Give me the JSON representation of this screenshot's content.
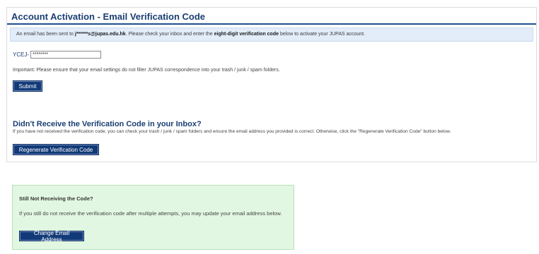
{
  "panel": {
    "title": "Account Activation - Email Verification Code",
    "info": {
      "pre": "An email has been sent to ",
      "email": "j******s@jupas.edu.hk",
      "mid": ". Please check your inbox and enter the ",
      "emphasis": "eight-digit verification code",
      "post": " below to activate your JUPAS account."
    },
    "code_prefix": "YCEJ-",
    "code_value": "********",
    "important": "Important: Please ensure that your email settings do not filter JUPAS correspondence into your trash / junk / spam folders.",
    "submit_label": "Submit",
    "resend_heading": "Didn't Receive the Verification Code in your Inbox?",
    "resend_text": "If you have not received the verification code, you can check your trash / junk / spam folders and ensure the email address you provided is correct. Otherwise, click the \"Regenerate Verification Code\" button below.",
    "regenerate_label": "Regenerate Verification Code"
  },
  "still_not": {
    "title": "Still Not Receiving the Code?",
    "text": "If you still do not receive the verification code after multiple attempts, you may update your email address below.",
    "change_label": "Change Email Address"
  },
  "colors": {
    "title_blue": "#1a3e73",
    "button_blue": "#123a78",
    "info_bg": "#e3edf9",
    "green_bg": "#e2f7e2"
  }
}
